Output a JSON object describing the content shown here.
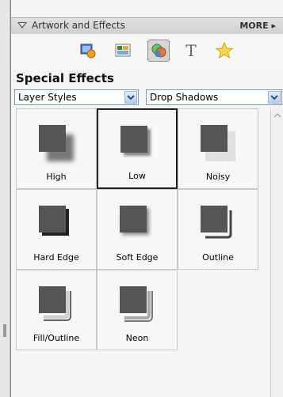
{
  "panel": {
    "title": "Artwork and Effects",
    "more_label": "MORE ▸"
  },
  "toolbar": {
    "buttons": [
      {
        "icon": "apply-to-photo-icon"
      },
      {
        "icon": "themes-icon"
      },
      {
        "icon": "special-effects-icon",
        "selected": true
      },
      {
        "icon": "text-icon"
      },
      {
        "icon": "favorites-star-icon"
      }
    ]
  },
  "section": {
    "title": "Special Effects"
  },
  "dropdowns": {
    "category": "Layer Styles",
    "style": "Drop Shadows"
  },
  "effects": [
    {
      "label": "High",
      "selected": false
    },
    {
      "label": "Low",
      "selected": true
    },
    {
      "label": "Noisy",
      "selected": false
    },
    {
      "label": "Hard Edge",
      "selected": false
    },
    {
      "label": "Soft Edge",
      "selected": false
    },
    {
      "label": "Outline",
      "selected": false
    },
    {
      "label": "Fill/Outline",
      "selected": false
    },
    {
      "label": "Neon",
      "selected": false
    }
  ],
  "colors": {
    "swatch": "#555555",
    "accent_blue": "#7f9db9"
  }
}
